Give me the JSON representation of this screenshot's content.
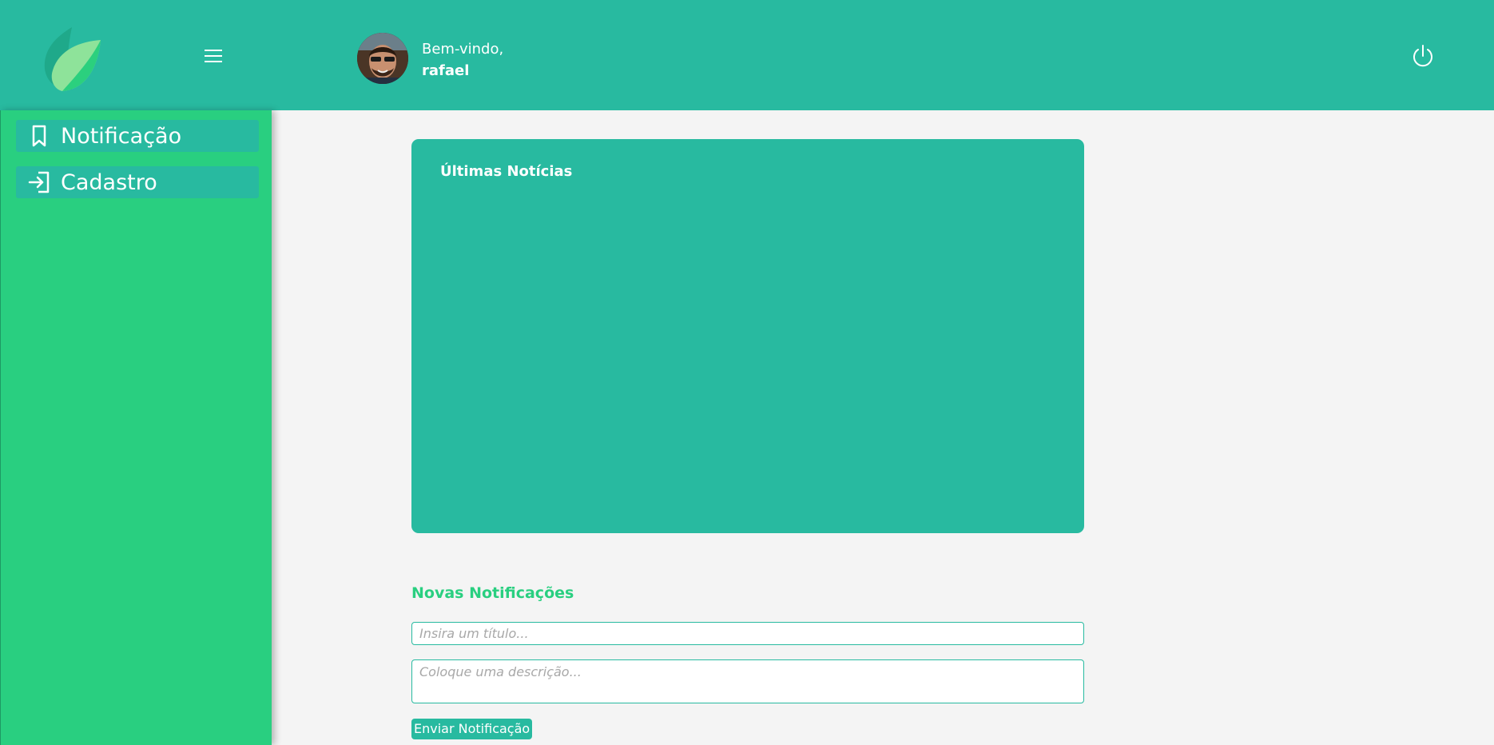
{
  "header": {
    "welcome": "Bem-vindo,",
    "username": "rafael",
    "logo_icon": "leaf-icon",
    "menu_icon": "hamburger-menu-icon",
    "power_icon": "power-icon"
  },
  "sidebar": {
    "items": [
      {
        "label": "Notificação",
        "icon": "bookmark-icon"
      },
      {
        "label": "Cadastro",
        "icon": "login-arrow-icon"
      }
    ]
  },
  "news": {
    "title": "Últimas Notícias"
  },
  "new_notification": {
    "heading": "Novas Notificações",
    "title_placeholder": "Insira um título...",
    "description_placeholder": "Coloque uma descrição...",
    "submit_label": "Enviar Notificação"
  },
  "colors": {
    "header": "#28baa0",
    "sidebar": "#29cf80",
    "accent": "#28baa0",
    "heading_green": "#29cf80",
    "background": "#f4f4f4"
  }
}
